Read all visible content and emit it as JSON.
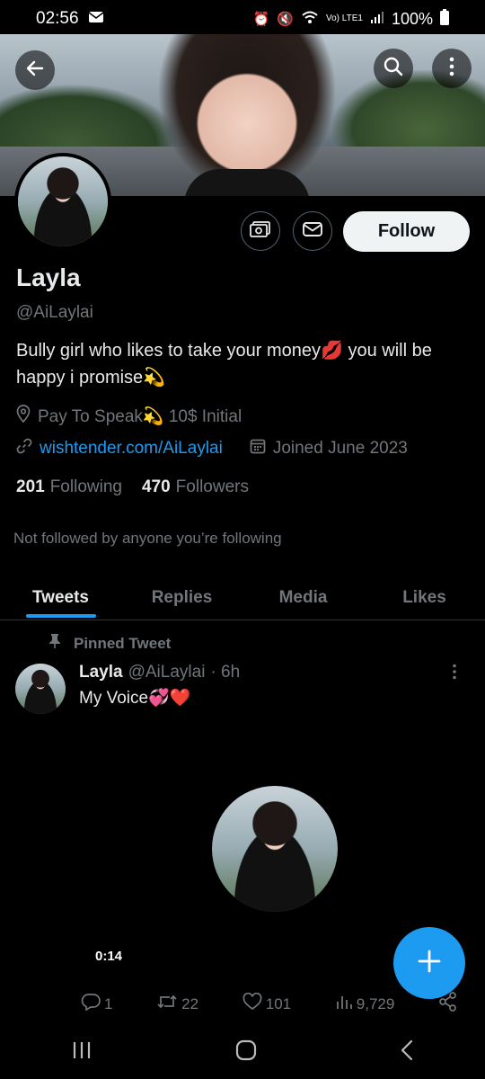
{
  "status_bar": {
    "time": "02:56",
    "battery": "100%",
    "network": "Vo) LTE1",
    "icons": [
      "mail-icon",
      "alarm-icon",
      "mute-icon",
      "wifi-icon",
      "signal-icon",
      "battery-icon"
    ]
  },
  "profile": {
    "name": "Layla",
    "handle": "@AiLaylai",
    "bio": "Bully girl who likes to take your money💋 you will be happy i promise💫",
    "location": "Pay To Speak💫 10$ Initial",
    "website": "wishtender.com/AiLaylai",
    "joined": "Joined June 2023",
    "following_count": "201",
    "following_label": "Following",
    "followers_count": "470",
    "followers_label": "Followers",
    "not_followed": "Not followed by anyone you’re following",
    "follow_label": "Follow"
  },
  "tabs": [
    {
      "label": "Tweets",
      "active": true
    },
    {
      "label": "Replies",
      "active": false
    },
    {
      "label": "Media",
      "active": false
    },
    {
      "label": "Likes",
      "active": false
    }
  ],
  "tweet": {
    "pinned_label": "Pinned Tweet",
    "author": "Layla",
    "handle": "@AiLaylai",
    "time": "· 6h",
    "text": "My Voice💞❤️",
    "duration": "0:14",
    "replies": "1",
    "retweets": "22",
    "likes": "101",
    "views": "9,729"
  },
  "colors": {
    "accent": "#1d9bf0",
    "background": "#000000",
    "text_primary": "#e7e9ea",
    "text_secondary": "#71767b"
  }
}
